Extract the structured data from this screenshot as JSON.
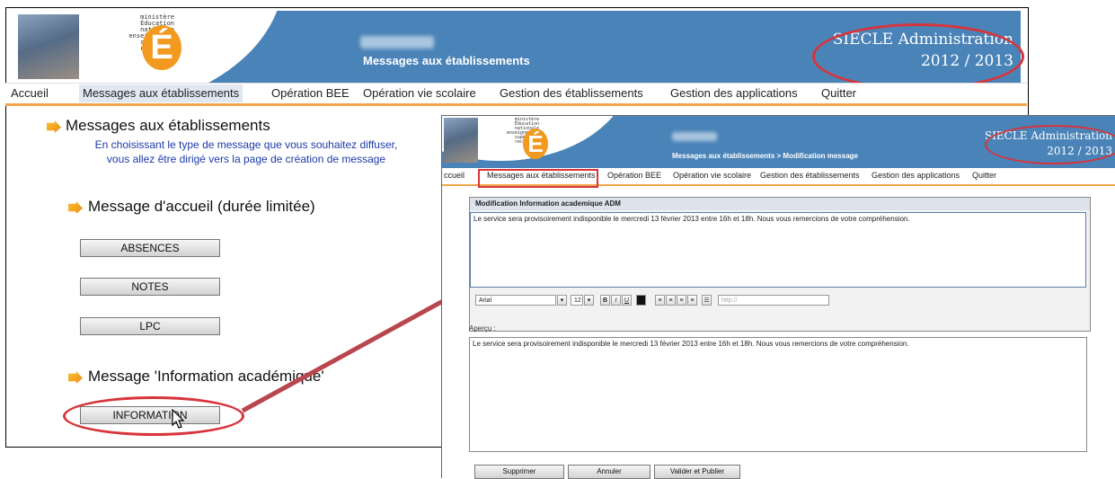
{
  "left_window": {
    "ministry_text": "ministère\nÉducation\nnationale\nenseignement\nsupérieur\nrecherche",
    "logo_letter": "É",
    "header_title": "Messages aux établissements",
    "app_title": "SIECLE Administration",
    "year": "2012 / 2013",
    "menu": [
      "Accueil",
      "Messages aux établissements",
      "Opération BEE",
      "Opération vie scolaire",
      "Gestion des établissements",
      "Gestion des applications",
      "Quitter"
    ],
    "section_title": "Messages aux établissements",
    "intro_line1": "En choisissant le type de message que vous souhaitez diffuser,",
    "intro_line2": "vous allez être dirigé vers la page de création de message",
    "welcome_title": "Message d'accueil (durée limitée)",
    "welcome_buttons": [
      "ABSENCES",
      "NOTES",
      "LPC"
    ],
    "info_title": "Message 'Information académique'",
    "info_button": "INFORMATION"
  },
  "right_window": {
    "ministry_text": "ministère\nÉducation\nnationale\nenseignement\nsupérieur\nrecherche",
    "logo_letter": "É",
    "header_title": "Messages aux établissements > Modification message",
    "app_title": "SIECLE Administration",
    "year": "2012 / 2013",
    "menu": [
      "ccueil",
      "Messages aux établissements",
      "Opération BEE",
      "Opération vie scolaire",
      "Gestion des établissements",
      "Gestion des applications",
      "Quitter"
    ],
    "panel_title": "Modification Information academique ADM",
    "message_text": "Le service sera provisoirement indisponible le mercredi 13 février 2013 entre 16h et 18h. Nous vous remercions de votre compréhension.",
    "toolbar": {
      "font": "Arial",
      "font_dropdown": "▾",
      "size": "12",
      "size_dropdown": "▾",
      "bold": "B",
      "italic": "I",
      "underline": "U",
      "link_placeholder": "http://"
    },
    "preview_label": "Aperçu :",
    "preview_text": "Le service sera provisoirement indisponible le mercredi 13 février 2013 entre 16h et 18h. Nous vous remercions de votre compréhension.",
    "buttons": [
      "Supprimer",
      "Annuler",
      "Valider et Publier"
    ]
  },
  "colors": {
    "header_blue": "#4a83b8",
    "menu_underline": "#f0a64a",
    "annotation_red": "#d8343b",
    "intro_blue": "#1d3aa8",
    "logo_orange": "#f29a1f"
  }
}
